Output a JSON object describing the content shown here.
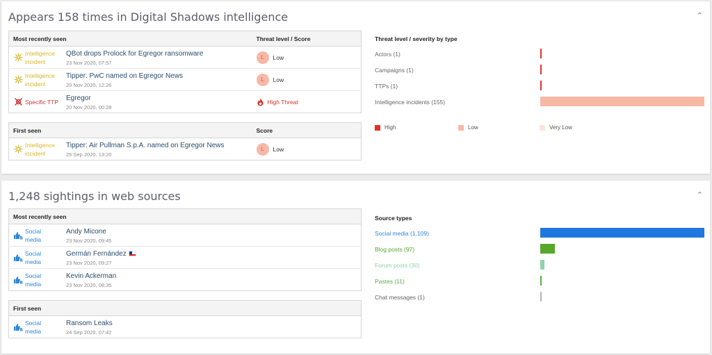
{
  "intel_panel": {
    "title": "Appears 158 times in Digital Shadows intelligence",
    "recent_table": {
      "col_1": "Most recently seen",
      "col_2": "Threat level / Score",
      "rows": [
        {
          "type_line1": "Intelligence",
          "type_line2": "incident",
          "title": "QBot drops Prolock for Egregor ransomware",
          "date": "23 Nov 2020, 07:57",
          "score_letter": "L",
          "score_text": "Low"
        },
        {
          "type_line1": "Intelligence",
          "type_line2": "incident",
          "title": "Tipper: PwC named on Egregor News",
          "date": "20 Nov 2020, 12:26",
          "score_letter": "L",
          "score_text": "Low"
        },
        {
          "type_line1": "Specific TTP",
          "title": "Egregor",
          "date": "20 Nov 2020, 00:28",
          "score_text": "High Threat"
        }
      ]
    },
    "first_table": {
      "col_1": "First seen",
      "col_2": "Score",
      "rows": [
        {
          "type_line1": "Intelligence",
          "type_line2": "incident",
          "title": "Tipper: Air Pullman S.p.A. named on Egregor News",
          "date": "25 Sep 2020, 13:20",
          "score_letter": "L",
          "score_text": "Low"
        }
      ]
    },
    "chart": {
      "title": "Threat level / severity by type",
      "legend": [
        {
          "label": "High",
          "color": "#e0302a"
        },
        {
          "label": "Low",
          "color": "#f7b9a4"
        },
        {
          "label": "Very Low",
          "color": "#fbe3dc"
        }
      ]
    }
  },
  "web_panel": {
    "title": "1,248 sightings in web sources",
    "recent_table": {
      "col_1": "Most recently seen",
      "rows": [
        {
          "type_line1": "Social",
          "type_line2": "media",
          "title": "Andy Micone",
          "date": "23 Nov 2020, 09:45"
        },
        {
          "type_line1": "Social",
          "type_line2": "media",
          "title": "Germán Fernández",
          "date": "23 Nov 2020, 09:27"
        },
        {
          "type_line1": "Social",
          "type_line2": "media",
          "title": "Kevin Ackerman",
          "date": "23 Nov 2020, 08:35"
        }
      ]
    },
    "first_table": {
      "col_1": "First seen",
      "rows": [
        {
          "type_line1": "Social",
          "type_line2": "media",
          "title": "Ransom Leaks",
          "date": "24 Sep 2020, 07:42"
        }
      ]
    },
    "chart": {
      "title": "Source types"
    }
  },
  "chart_data": [
    {
      "type": "bar",
      "title": "Threat level / severity by type",
      "categories": [
        "Actors (1)",
        "Campaigns (1)",
        "TTPs (1)",
        "Intelligence incidents (155)"
      ],
      "series": [
        {
          "name": "High",
          "values": [
            1,
            1,
            1,
            0
          ],
          "color": "#e0302a"
        },
        {
          "name": "Low",
          "values": [
            0,
            0,
            0,
            155
          ],
          "color": "#f7b9a4"
        },
        {
          "name": "Very Low",
          "values": [
            0,
            0,
            0,
            0
          ],
          "color": "#fbe3dc"
        }
      ],
      "xlim": [
        0,
        155
      ],
      "grid": false,
      "legend": "bottom"
    },
    {
      "type": "bar",
      "title": "Source types",
      "categories": [
        "Social media (1,109)",
        "Blog posts (97)",
        "Forum posts (30)",
        "Pastes (11)",
        "Chat messages (1)"
      ],
      "values": [
        1109,
        97,
        30,
        11,
        1
      ],
      "colors": [
        "#1f78e0",
        "#57a82a",
        "#8ed3a8",
        "#56b04a",
        "#b4b4b4"
      ],
      "label_colors": [
        "#2d86d9",
        "#57a82a",
        "#8ed3a8",
        "#56b04a",
        "#666666"
      ],
      "xlim": [
        0,
        1109
      ],
      "grid": false
    }
  ]
}
